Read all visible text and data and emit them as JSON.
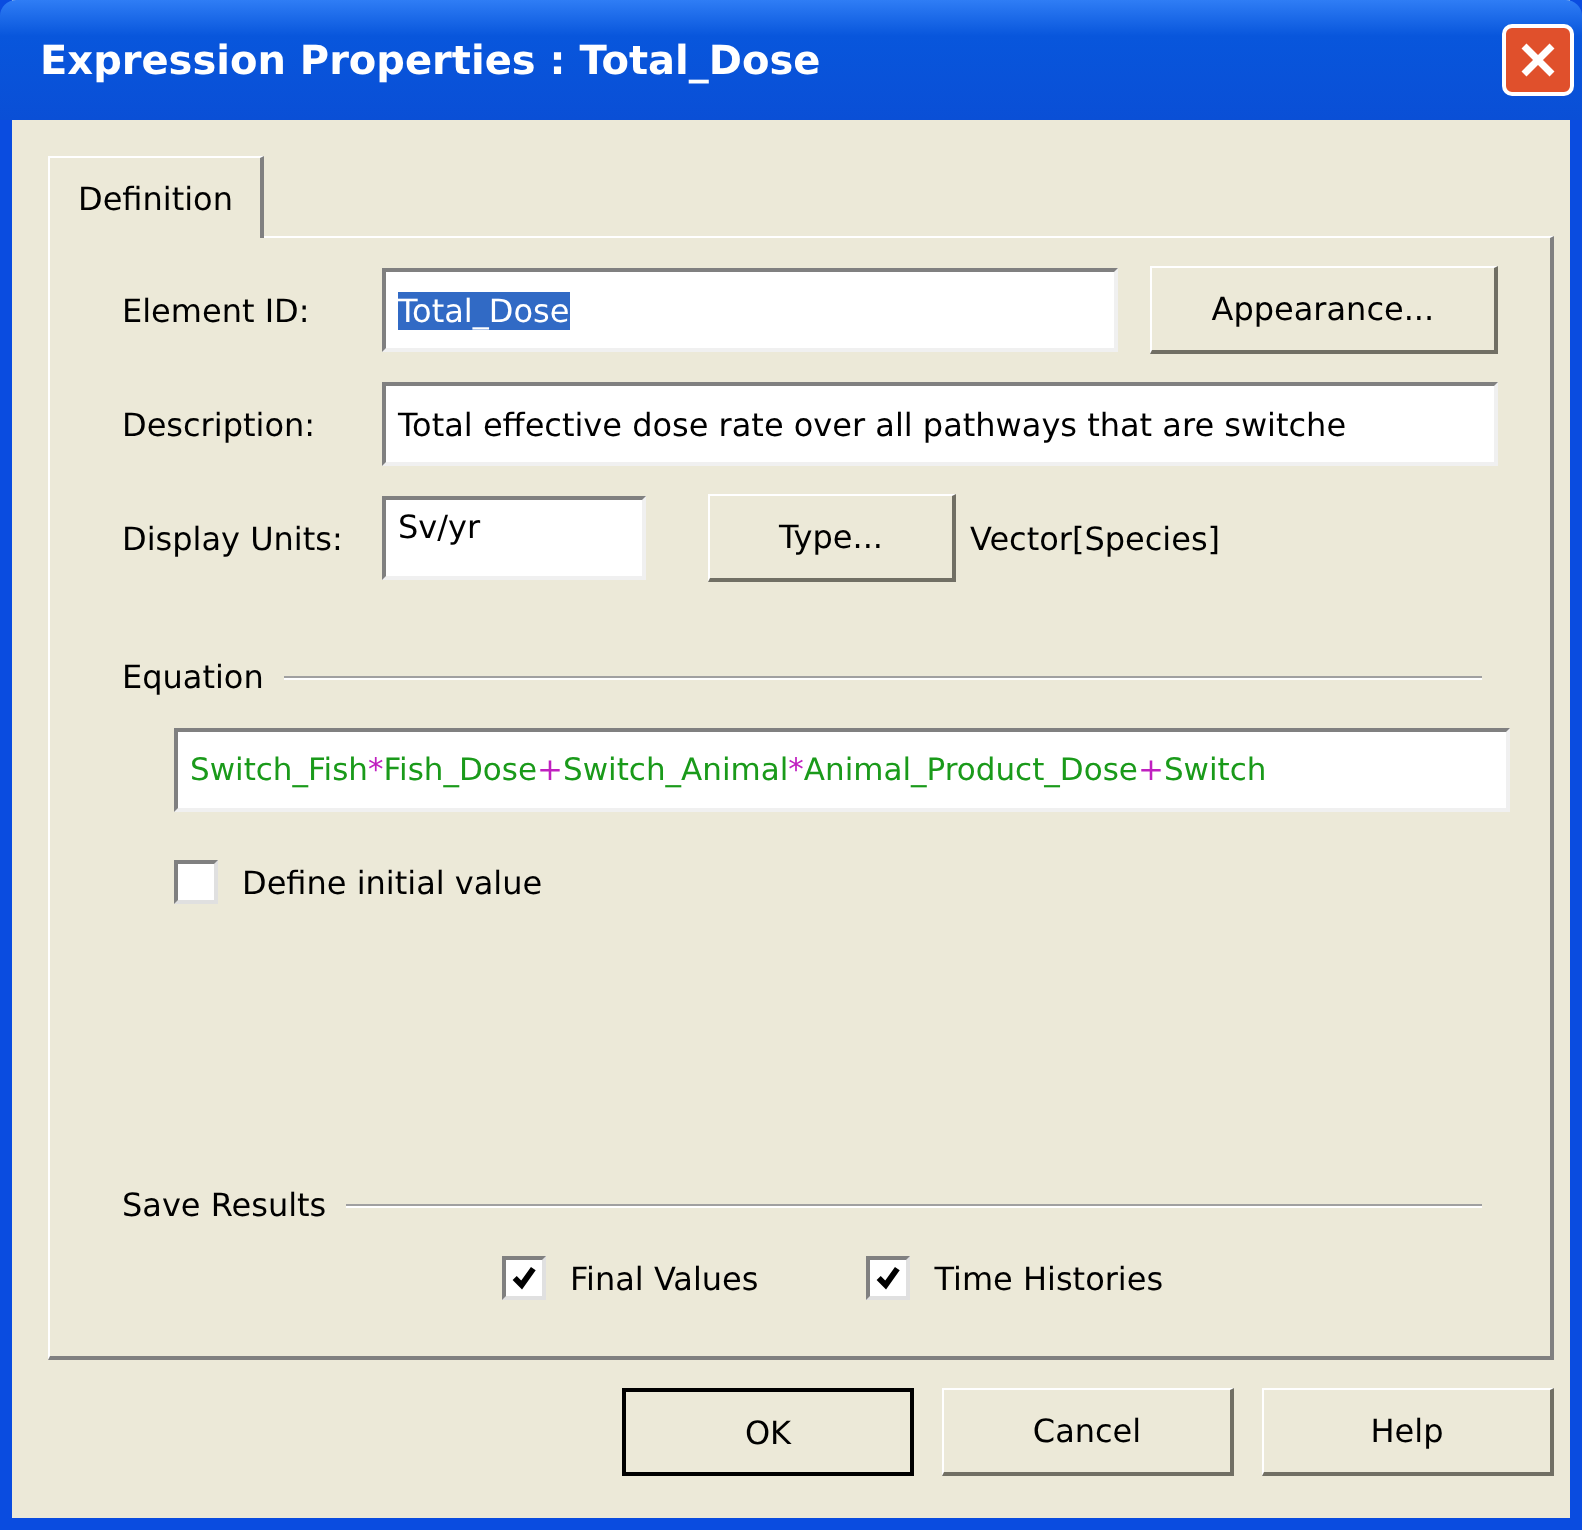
{
  "window": {
    "title": "Expression Properties : Total_Dose"
  },
  "tabs": [
    {
      "label": "Definition",
      "selected": true
    }
  ],
  "element_id": {
    "label": "Element ID:",
    "value": "Total_Dose",
    "highlighted": true
  },
  "appearance_button": "Appearance...",
  "description": {
    "label": "Description:",
    "value": "Total effective dose rate over all pathways that are switche"
  },
  "display_units": {
    "label": "Display Units:",
    "value": "Sv/yr"
  },
  "type_button": "Type...",
  "type_value": "Vector[Species]",
  "equation": {
    "heading": "Equation",
    "tokens": [
      {
        "kind": "name",
        "text": "Switch_Fish"
      },
      {
        "kind": "operator",
        "text": "*"
      },
      {
        "kind": "name",
        "text": "Fish_Dose"
      },
      {
        "kind": "operator",
        "text": "+"
      },
      {
        "kind": "name",
        "text": "Switch_Animal"
      },
      {
        "kind": "operator",
        "text": "*"
      },
      {
        "kind": "name",
        "text": "Animal_Product_Dose"
      },
      {
        "kind": "operator",
        "text": "+"
      },
      {
        "kind": "name",
        "text": "Switch"
      }
    ]
  },
  "define_initial_value": {
    "label": "Define initial value",
    "checked": false
  },
  "save_results": {
    "heading": "Save Results",
    "options": [
      {
        "label": "Final Values",
        "checked": true
      },
      {
        "label": "Time Histories",
        "checked": true
      }
    ]
  },
  "buttons": [
    {
      "label": "OK",
      "default": true
    },
    {
      "label": "Cancel",
      "default": false
    },
    {
      "label": "Help",
      "default": false
    }
  ]
}
